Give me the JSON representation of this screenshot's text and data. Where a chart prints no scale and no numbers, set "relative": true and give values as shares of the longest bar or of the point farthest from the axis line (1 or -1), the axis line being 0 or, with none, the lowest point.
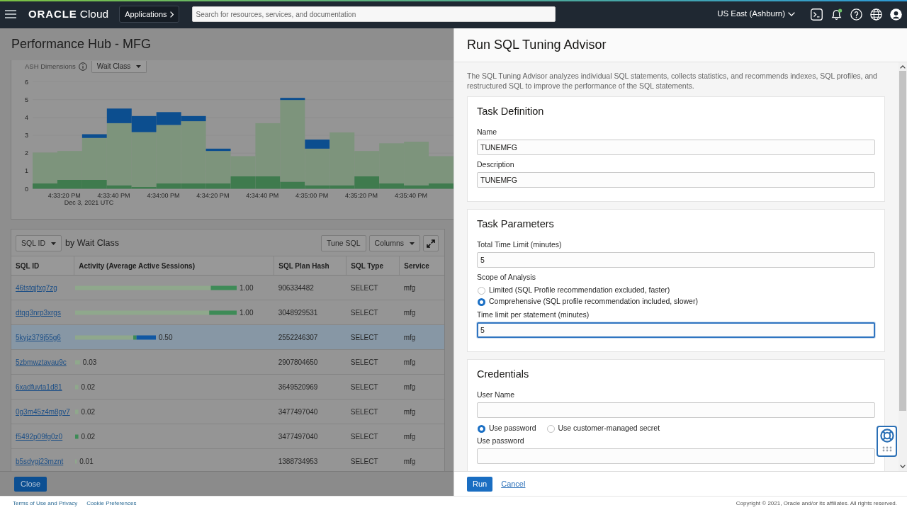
{
  "top_bar": {
    "brand": "ORACLE",
    "product": "Cloud",
    "apps_button": "Applications",
    "search": {
      "placeholder": "Search for resources, services, and documentation"
    },
    "region": "US East (Ashburn)"
  },
  "page": {
    "title": "Performance Hub - MFG"
  },
  "ash_panel": {
    "label": "ASH Dimensions",
    "dimension": "Wait Class",
    "chart_data": [
      {
        "type": "bar",
        "stacked": true,
        "categories": [
          null,
          "4:33:20 PM",
          null,
          "4:33:40 PM",
          null,
          "4:34:00 PM",
          null,
          "4:34:20 PM",
          null,
          "4:34:40 PM",
          null,
          "4:35:00 PM",
          null,
          "4:35:20 PM",
          null,
          "4:35:40 PM",
          null
        ],
        "series": [
          {
            "color": "#3f7b4e",
            "values": [
              0.3,
              0.5,
              0.5,
              0.2,
              0.1,
              0.3,
              0.3,
              0.3,
              0.7,
              0.7,
              0.4,
              0.2,
              0.2,
              0.7,
              0.3,
              0.2,
              0.3
            ]
          },
          {
            "color": "#7d947c",
            "values": [
              1.73,
              1.62,
              2.35,
              3.48,
              3.08,
              3.28,
              3.49,
              1.82,
              1.13,
              2.98,
              4.58,
              2.05,
              2.96,
              1.42,
              2.25,
              2.44,
              1.53
            ]
          },
          {
            "color": "#0c4e8f",
            "values": [
              0,
              0,
              0.21,
              0.82,
              0.9,
              0.72,
              0.29,
              0.13,
              0,
              0,
              0.12,
              0.51,
              0,
              0,
              0,
              0,
              0
            ]
          }
        ],
        "ylim": [
          0,
          6
        ],
        "yticks": [
          0,
          1,
          2,
          3,
          4,
          5,
          6
        ],
        "grid": true,
        "annotations": [
          "Dec 3, 2021 UTC"
        ]
      }
    ]
  },
  "sql_table": {
    "group_by": "SQL ID",
    "title": "by Wait Class",
    "tune_button": "Tune SQL",
    "columns_button": "Columns",
    "columns": [
      "SQL ID",
      "Activity (Average Active Sessions)",
      "SQL Plan Hash",
      "SQL Type",
      "Service"
    ],
    "rows": [
      {
        "sql_id": "46tstqjfxg7zg",
        "plan_hash": "906334482",
        "sql_type": "SELECT",
        "service": "mfg",
        "selected": false
      },
      {
        "sql_id": "dtqq3nrp3xrgs",
        "plan_hash": "3048929531",
        "sql_type": "SELECT",
        "service": "mfg",
        "selected": false
      },
      {
        "sql_id": "5kyjz379j55g6",
        "plan_hash": "2552246307",
        "sql_type": "SELECT",
        "service": "mfg",
        "selected": true
      },
      {
        "sql_id": "5zbmwztavau9c",
        "plan_hash": "2907804650",
        "sql_type": "SELECT",
        "service": "mfg",
        "selected": false
      },
      {
        "sql_id": "6xadfuvta1d81",
        "plan_hash": "3649520969",
        "sql_type": "SELECT",
        "service": "mfg",
        "selected": false
      },
      {
        "sql_id": "0g3m45z4m8gv7",
        "plan_hash": "3477497040",
        "sql_type": "SELECT",
        "service": "mfg",
        "selected": false
      },
      {
        "sql_id": "f5492p09fg0z0",
        "plan_hash": "3477497040",
        "sql_type": "SELECT",
        "service": "mfg",
        "selected": false
      },
      {
        "sql_id": "b5sdygj23mznt",
        "plan_hash": "1388734953",
        "sql_type": "SELECT",
        "service": "mfg",
        "selected": false
      }
    ],
    "chart_data": [
      {
        "type": "bar",
        "orientation": "horizontal",
        "stacked": true,
        "relative": true,
        "categories": [
          null,
          null,
          null,
          null,
          null,
          null,
          null,
          null
        ],
        "series": [
          {
            "color": "#8fa88c",
            "values": [
              0.84,
              0.83,
              0.36,
              0.03,
              0.02,
              0.02,
              0,
              0.01
            ]
          },
          {
            "color": "#3e8b57",
            "values": [
              0.16,
              0.17,
              0.02,
              0,
              0,
              0,
              0.02,
              0
            ]
          },
          {
            "color": "#1158a3",
            "values": [
              0,
              0,
              0.12,
              0,
              0,
              0,
              0,
              0
            ]
          }
        ],
        "value_labels": [
          "1.00",
          "1.00",
          "0.50",
          "0.03",
          "0.02",
          "0.02",
          "0.02",
          "0.01"
        ]
      }
    ]
  },
  "close_button": "Close",
  "drawer": {
    "title": "Run SQL Tuning Advisor",
    "intro": "The SQL Tuning Advisor analyzes individual SQL statements, collects statistics, and recommends indexes, SQL profiles, and restructured SQL to improve the performance of the SQL statements.",
    "sections": [
      {
        "title": "Task Definition",
        "fields": [
          {
            "kind": "input",
            "label": "Name",
            "value": "TUNEMFG",
            "focused": false
          },
          {
            "kind": "input",
            "label": "Description",
            "value": "TUNEMFG",
            "focused": false
          }
        ]
      },
      {
        "title": "Task Parameters",
        "fields": [
          {
            "kind": "input",
            "label": "Total Time Limit (minutes)",
            "value": "5",
            "focused": false
          },
          {
            "kind": "radiolist",
            "label": "Scope of Analysis",
            "options": [
              {
                "label": "Limited (SQL Profile recommendation excluded, faster)",
                "selected": false
              },
              {
                "label": "Comprehensive (SQL profile recommendation included, slower)",
                "selected": true
              }
            ]
          },
          {
            "kind": "input",
            "label": "Time limit per statement (minutes)",
            "value": "5",
            "focused": true
          }
        ]
      },
      {
        "title": "Credentials",
        "fields": [
          {
            "kind": "input",
            "label": "User Name",
            "focused": false
          },
          {
            "kind": "radiorow",
            "options": [
              {
                "label": "Use password",
                "selected": true
              },
              {
                "label": "Use customer-managed secret",
                "selected": false
              }
            ]
          },
          {
            "kind": "input",
            "label": "Use password",
            "focused": false
          }
        ]
      }
    ],
    "run_button": "Run",
    "cancel_link": "Cancel"
  },
  "footer": {
    "links": [
      "Terms of Use and Privacy",
      "Cookie Preferences"
    ],
    "copyright": "Copyright © 2021, Oracle and/or its affiliates. All rights reserved."
  }
}
